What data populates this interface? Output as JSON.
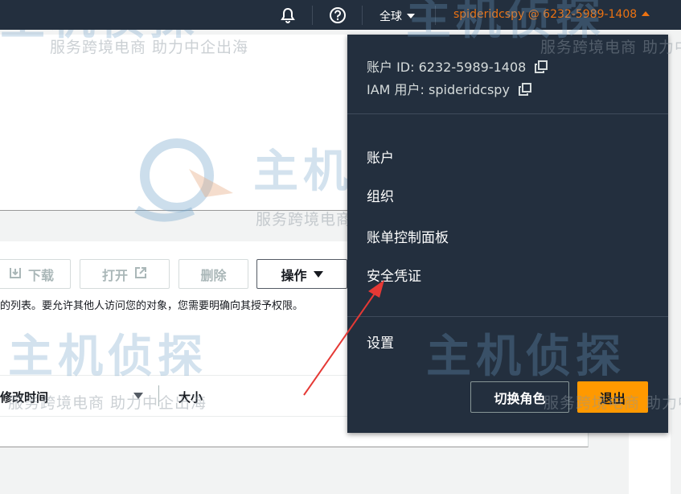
{
  "topbar": {
    "bell_icon": "bell-icon",
    "help_icon": "help-circle-icon",
    "region_label": "全球",
    "user_label": "spideridcspy @ 6232-5989-1408"
  },
  "dropdown": {
    "account_id": "账户 ID: 6232-5989-1408",
    "iam_user": "IAM 用户: spideridcspy",
    "items": [
      "账户",
      "组织",
      "账单控制面板",
      "安全凭证"
    ],
    "settings": "设置",
    "switch_role": "切换角色",
    "logout": "退出"
  },
  "toolbar": {
    "download": "下载",
    "open": "打开",
    "delete": "删除",
    "actions": "操作"
  },
  "notice": "的列表。要允许其他人访问您的对象，您需要明确向其授予权限。",
  "table": {
    "col_modified": "修改时间",
    "col_size": "大小"
  },
  "watermark": {
    "brand": "主机侦探",
    "slogan": "服务跨境电商 助力中企出海"
  },
  "colors": {
    "navbar": "#232f3e",
    "accent_orange": "#ec7211",
    "logout_button": "#ff9900",
    "annotation_arrow": "#e53935"
  }
}
